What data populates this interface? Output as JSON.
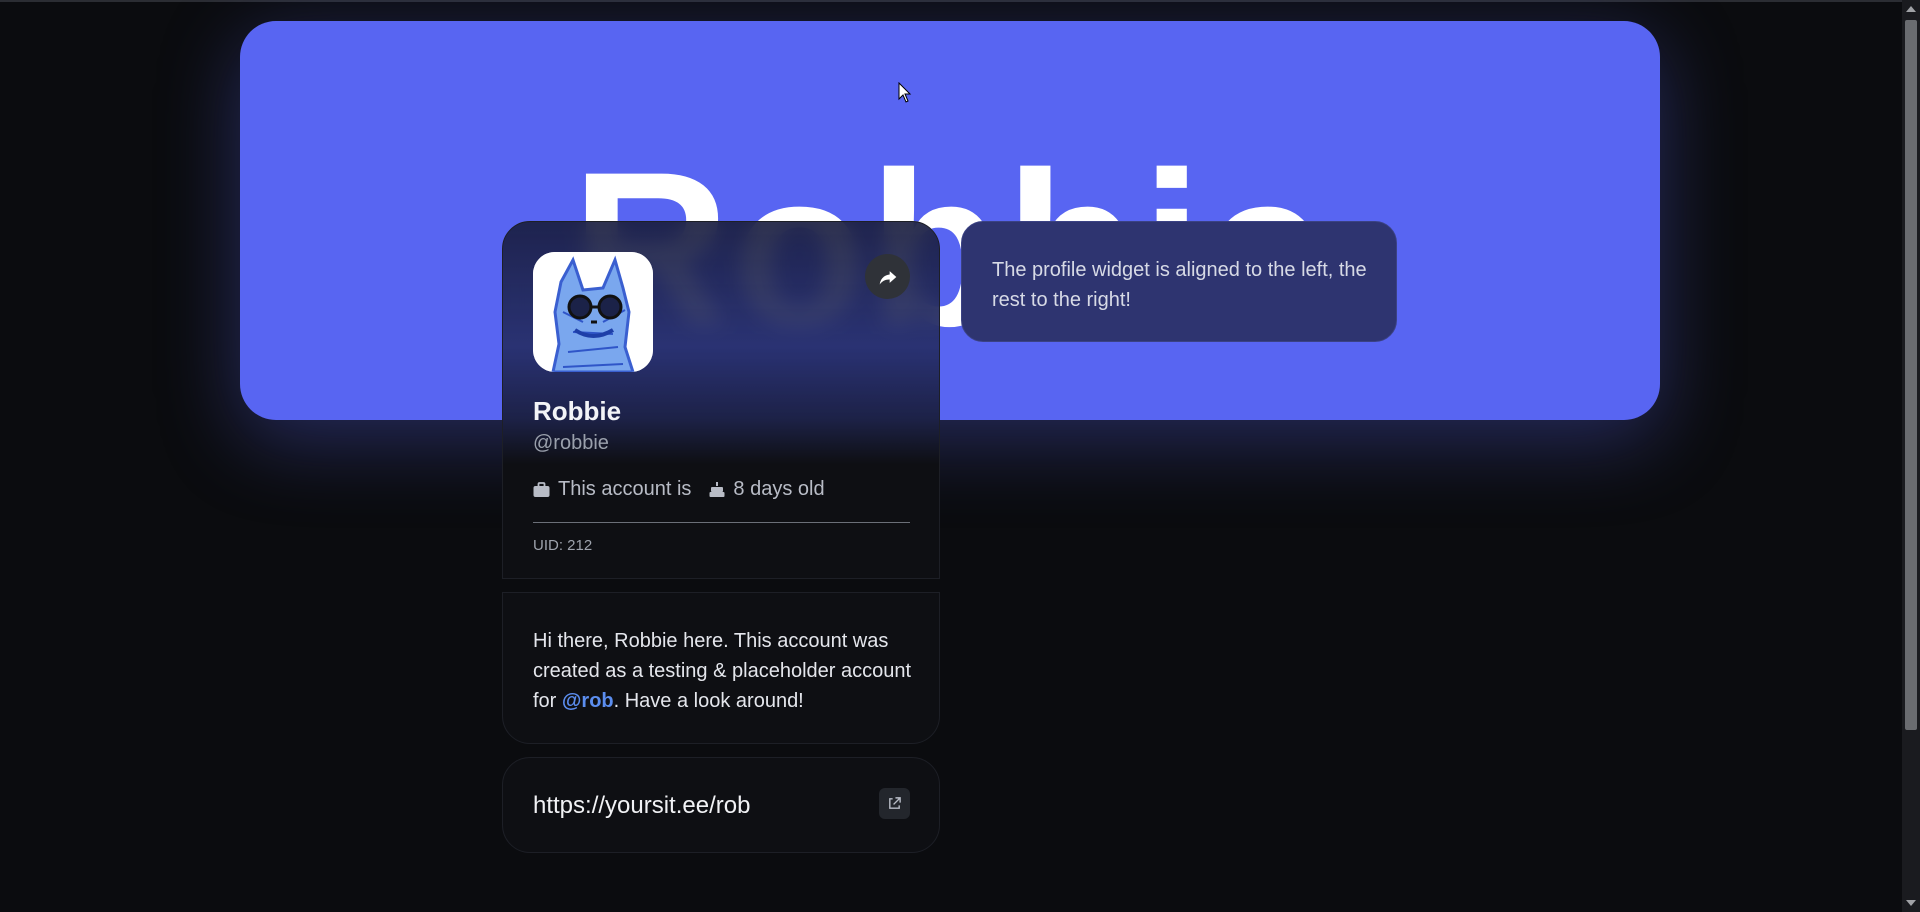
{
  "banner": {
    "name": "Robbie",
    "color": "#5865f2"
  },
  "profile": {
    "display_name": "Robbie",
    "handle": "@robbie",
    "stats": {
      "account_label": "This account is",
      "age_label": "8 days old"
    },
    "uid": "UID: 212",
    "share_icon": "share-arrow-icon"
  },
  "info": {
    "text": "The profile widget is aligned to the left, the rest to the right!"
  },
  "bio": {
    "text_before": "Hi there, Robbie here. This account was created as a testing & placeholder account for ",
    "mention": "@rob",
    "text_after": ". Have a look around!"
  },
  "link": {
    "url": "https://yoursit.ee/rob",
    "icon": "external-link-icon"
  },
  "colors": {
    "accent": "#5865f2",
    "mention": "#5b8dee",
    "background": "#0b0c0f"
  }
}
